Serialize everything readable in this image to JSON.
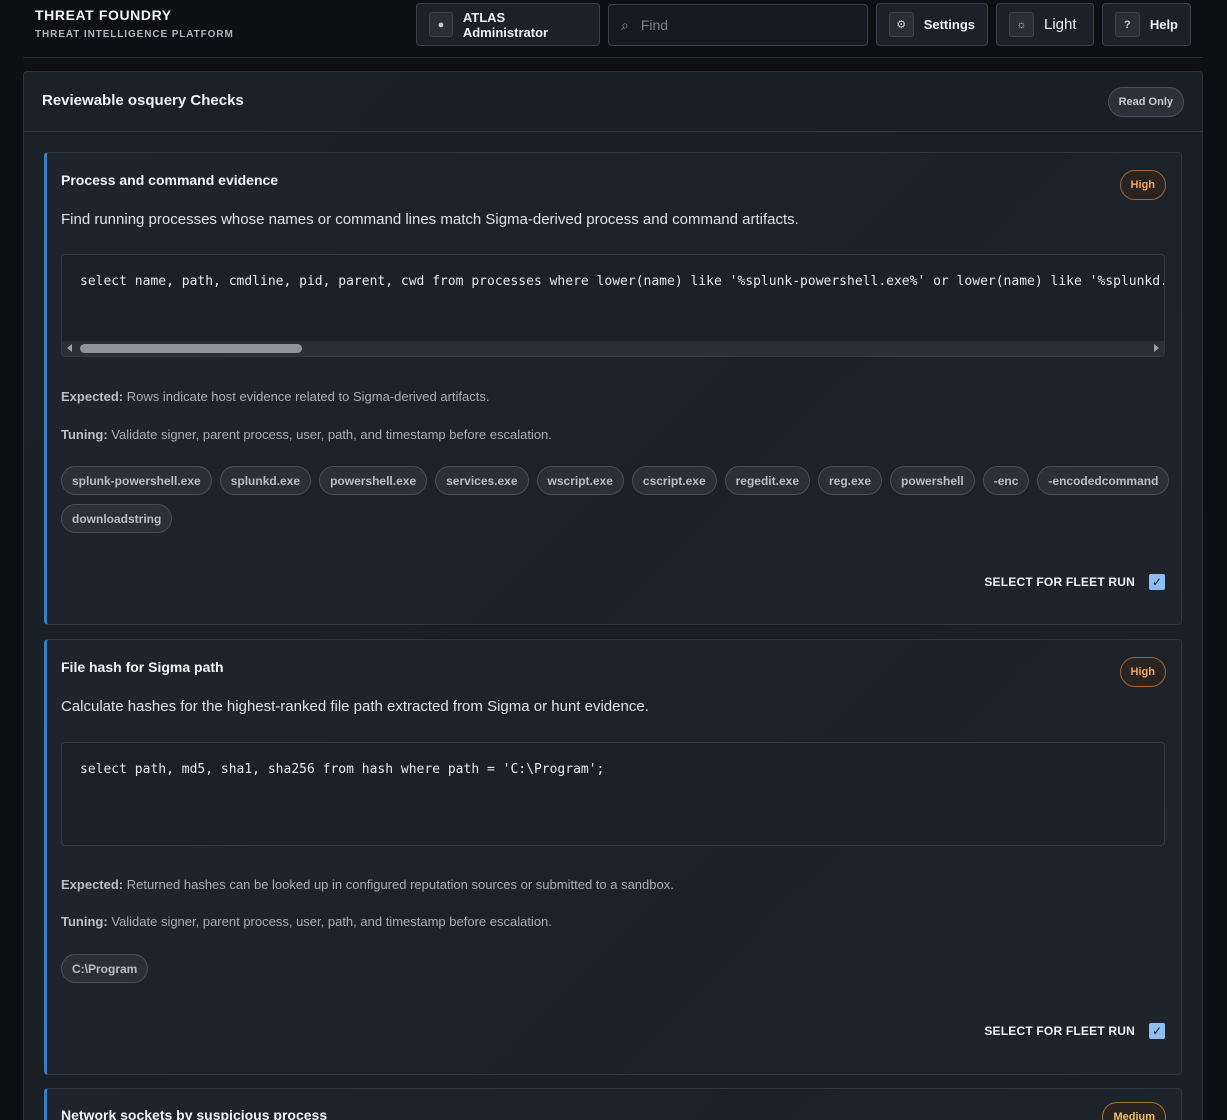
{
  "header": {
    "brand": "THREAT FOUNDRY",
    "subtitle": "THREAT INTELLIGENCE PLATFORM",
    "user_label": "ATLAS Administrator",
    "search_placeholder": "Find",
    "settings_label": "Settings",
    "theme_label": "Light",
    "help_label": "Help",
    "icons": {
      "user": "dot-icon",
      "search": "search-icon",
      "settings": "gear-icon",
      "theme": "sun-icon",
      "help": "question-icon"
    }
  },
  "panel": {
    "title": "Reviewable osquery Checks",
    "badge": "Read Only"
  },
  "checks": [
    {
      "title": "Process and command evidence",
      "severity": "High",
      "description": "Find running processes whose names or command lines match Sigma-derived process and command artifacts.",
      "query": "select name, path, cmdline, pid, parent, cwd from processes where lower(name) like '%splunk-powershell.exe%' or lower(name) like '%splunkd.exe%'",
      "expected_label": "Expected:",
      "expected": "Rows indicate host evidence related to Sigma-derived artifacts.",
      "tuning_label": "Tuning:",
      "tuning": "Validate signer, parent process, user, path, and timestamp before escalation.",
      "tags": [
        "splunk-powershell.exe",
        "splunkd.exe",
        "powershell.exe",
        "services.exe",
        "wscript.exe",
        "cscript.exe",
        "regedit.exe",
        "reg.exe",
        "powershell",
        "-enc",
        "-encodedcommand",
        "downloadstring"
      ],
      "fleet_label": "SELECT FOR FLEET RUN",
      "selected": true
    },
    {
      "title": "File hash for Sigma path",
      "severity": "High",
      "description": "Calculate hashes for the highest-ranked file path extracted from Sigma or hunt evidence.",
      "query": "select path, md5, sha1, sha256 from hash where path = 'C:\\Program';",
      "expected_label": "Expected:",
      "expected": "Returned hashes can be looked up in configured reputation sources or submitted to a sandbox.",
      "tuning_label": "Tuning:",
      "tuning": "Validate signer, parent process, user, path, and timestamp before escalation.",
      "tags": [
        "C:\\Program"
      ],
      "fleet_label": "SELECT FOR FLEET RUN",
      "selected": true
    },
    {
      "title": "Network sockets by suspicious process",
      "severity": "Medium"
    }
  ]
}
